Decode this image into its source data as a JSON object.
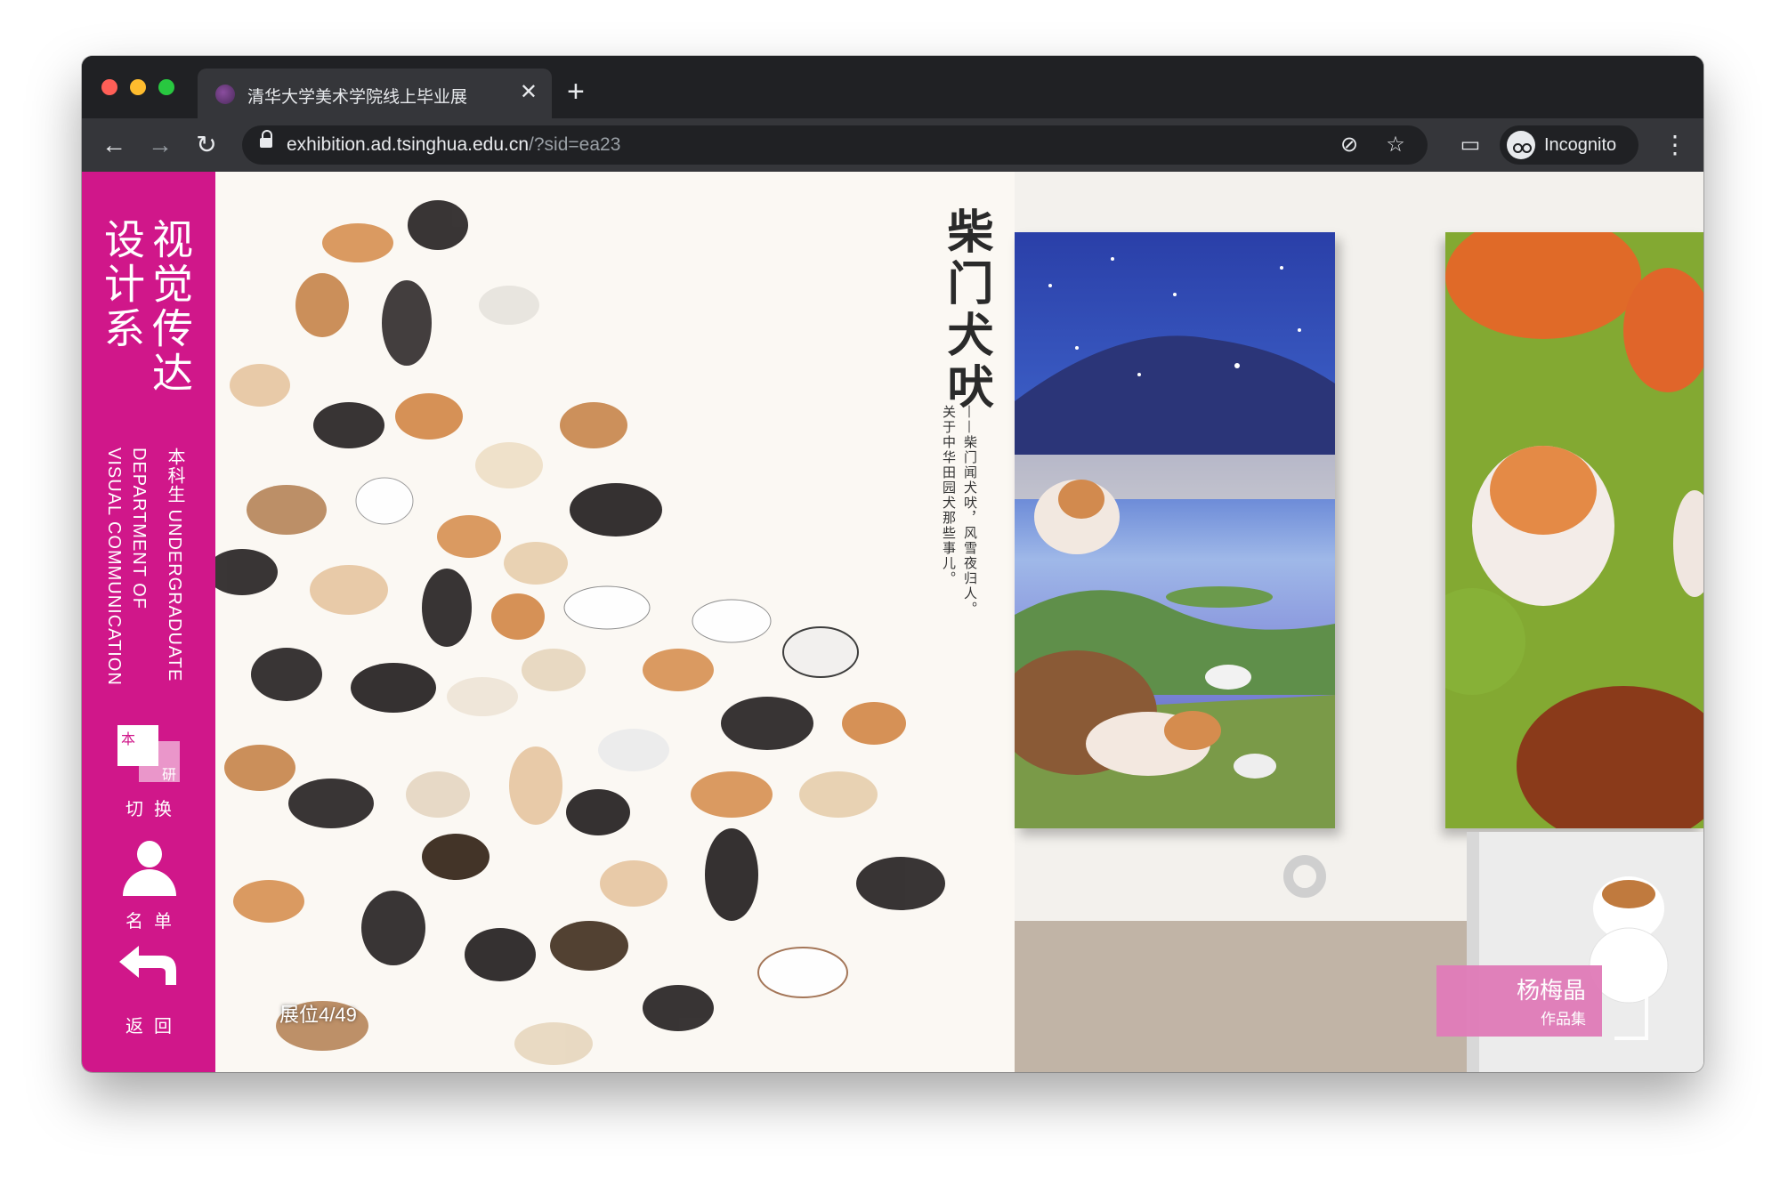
{
  "browser": {
    "tab_title": "清华大学美术学院线上毕业展",
    "tab_close": "✕",
    "new_tab": "+",
    "url_host": "exhibition.ad.tsinghua.edu.cn",
    "url_rest": "/?sid=ea23",
    "incognito_label": "Incognito",
    "icons": {
      "back": "←",
      "forward": "→",
      "reload": "↻",
      "eye_off": "⊘",
      "star": "☆",
      "cast": "▭",
      "menu": "⋮"
    }
  },
  "sidebar": {
    "dept_cn_line1": "视觉传达",
    "dept_cn_line2": "设计系",
    "dept_en_line1": "本科生 UNDERGRADUATE",
    "dept_en_line2": "DEPARTMENT OF",
    "dept_en_line3": "VISUAL COMMUNICATION",
    "switch_top": "本",
    "switch_bottom": "研",
    "switch_label": "切换",
    "roster_label": "名单",
    "back_label": "返回"
  },
  "artwork": {
    "title": "柴门犬吠",
    "subtitle_line1": "——柴门闻犬吠，风雪夜归人。",
    "subtitle_line2": "关于中华田园犬那些事儿。",
    "booth": "展位4/49"
  },
  "artist": {
    "name": "杨梅晶",
    "portfolio": "作品集"
  },
  "colors": {
    "accent": "#d0178a",
    "tag": "#e07bb8"
  }
}
